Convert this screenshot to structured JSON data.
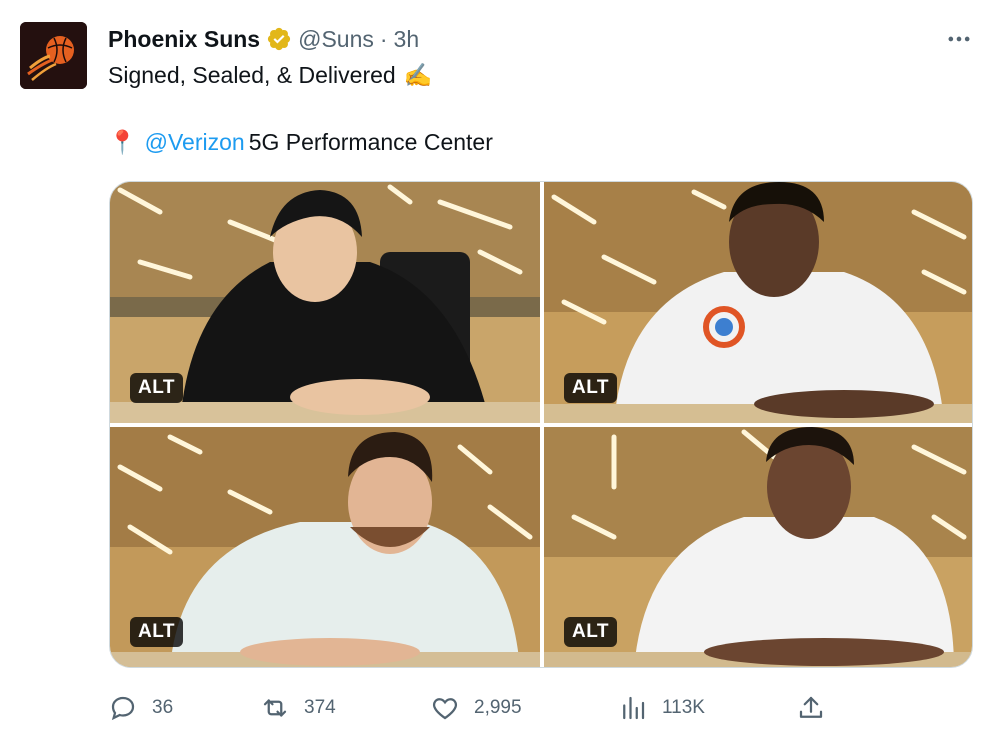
{
  "author": {
    "display_name": "Phoenix Suns",
    "handle": "@Suns",
    "separator": "·",
    "time": "3h",
    "verified": true,
    "avatar_icon": "suns-logo-icon"
  },
  "tweet": {
    "line1_text": "Signed, Sealed, & Delivered",
    "line1_emoji": "✍️",
    "line2_pin": "📍",
    "line2_mention": "@Verizon",
    "line2_text": "5G Performance Center"
  },
  "media": [
    {
      "alt_label": "ALT"
    },
    {
      "alt_label": "ALT"
    },
    {
      "alt_label": "ALT"
    },
    {
      "alt_label": "ALT"
    }
  ],
  "actions": {
    "replies": "36",
    "retweets": "374",
    "likes": "2,995",
    "views": "113K"
  },
  "colors": {
    "accent": "#1d9bf0",
    "verified_gold": "#e2b719",
    "muted": "#536471"
  }
}
